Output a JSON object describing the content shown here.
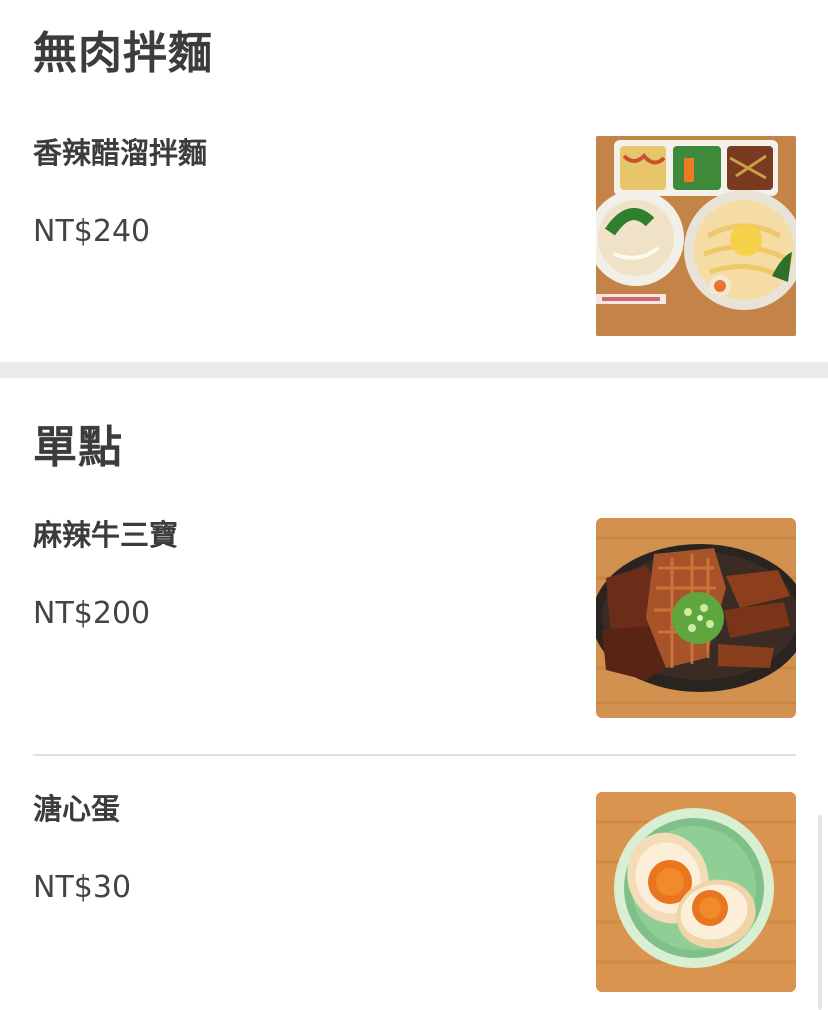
{
  "sections": [
    {
      "title": "無肉拌麵",
      "items": [
        {
          "name": "香辣醋溜拌麵",
          "price": "NT$240",
          "image_icon": "noodle-set-photo"
        }
      ]
    },
    {
      "title": "單點",
      "items": [
        {
          "name": "麻辣牛三寶",
          "price": "NT$200",
          "image_icon": "braised-beef-tripe-photo"
        },
        {
          "name": "溏心蛋",
          "price": "NT$30",
          "image_icon": "soft-boiled-egg-photo"
        }
      ]
    }
  ],
  "colors": {
    "title_text": "#3c3c3c",
    "price_text": "#444444",
    "section_divider": "#ebebeb",
    "item_divider": "#e0e0e0"
  }
}
